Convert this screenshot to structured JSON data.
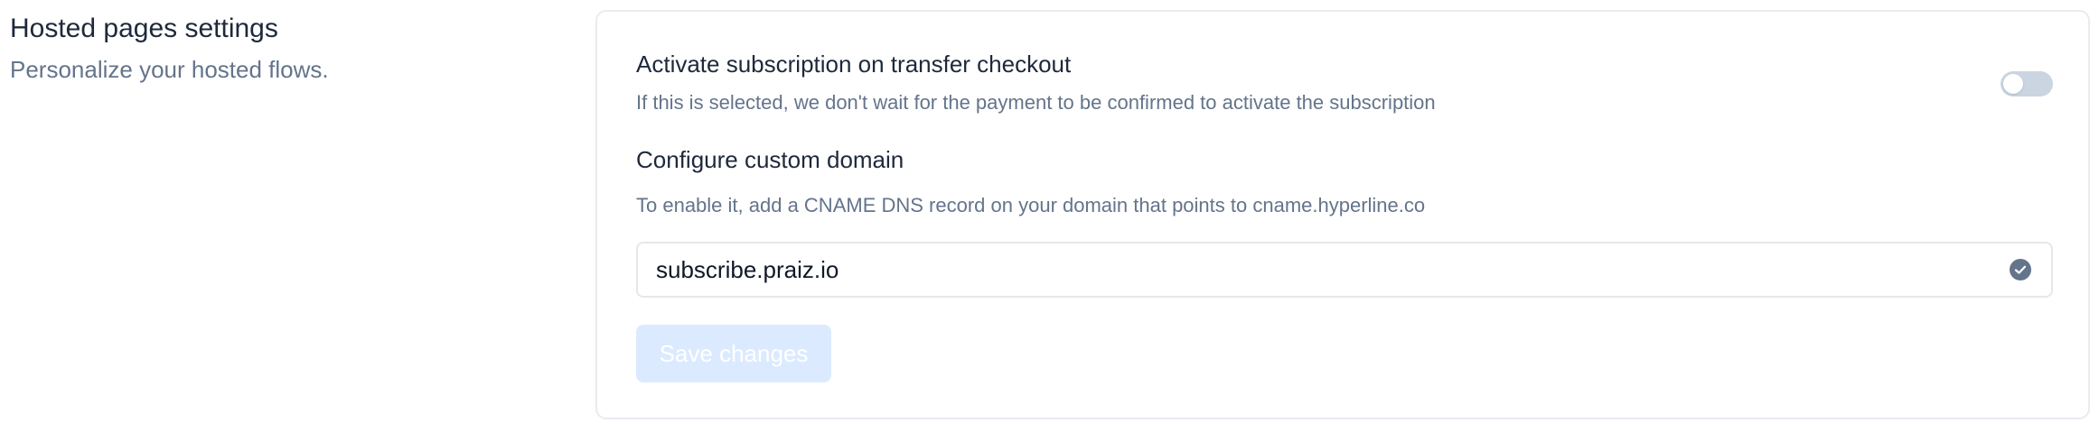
{
  "section": {
    "title": "Hosted pages settings",
    "subtitle": "Personalize your hosted flows."
  },
  "transfer_checkout": {
    "title": "Activate subscription on transfer checkout",
    "description": "If this is selected, we don't wait for the payment to be confirmed to activate the subscription",
    "enabled": false
  },
  "custom_domain": {
    "title": "Configure custom domain",
    "description": "To enable it, add a CNAME DNS record on your domain that points to cname.hyperline.co",
    "value": "subscribe.praiz.io",
    "status_icon": "check-circle-icon"
  },
  "actions": {
    "save_label": "Save changes",
    "save_disabled": true
  },
  "colors": {
    "toggle_off": "#cbd5e1",
    "check_icon": "#64748b",
    "save_disabled_bg": "#dbeafe"
  }
}
